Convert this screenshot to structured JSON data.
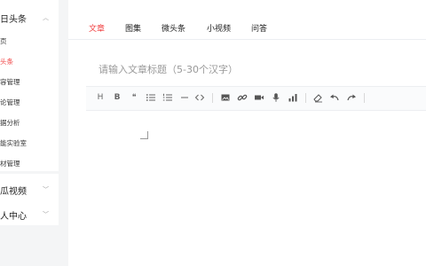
{
  "sidebar": {
    "app": {
      "title": "日头条"
    },
    "items": [
      {
        "label": "页"
      },
      {
        "label": "头条"
      },
      {
        "label": "容管理"
      },
      {
        "label": "论管理"
      },
      {
        "label": "据分析"
      },
      {
        "label": "能实验室"
      },
      {
        "label": "材管理"
      }
    ],
    "groups": [
      {
        "label": "瓜视频"
      },
      {
        "label": "人中心"
      }
    ]
  },
  "tabs": [
    {
      "label": "文章"
    },
    {
      "label": "图集"
    },
    {
      "label": "微头条"
    },
    {
      "label": "小视频"
    },
    {
      "label": "问答"
    }
  ],
  "editor": {
    "title_placeholder": "请输入文章标题（5-30个汉字）"
  },
  "toolbar": {
    "heading": "H",
    "bold": "B",
    "quote": "❝"
  },
  "colors": {
    "accent": "#f04142"
  }
}
